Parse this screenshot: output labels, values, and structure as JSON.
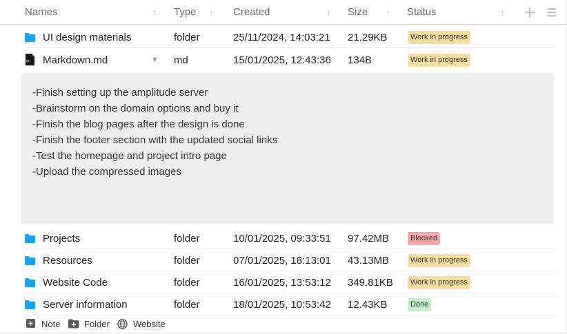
{
  "header": {
    "columns": [
      {
        "label": "Names"
      },
      {
        "label": "Type"
      },
      {
        "label": "Created"
      },
      {
        "label": "Size"
      },
      {
        "label": "Status"
      }
    ],
    "sort_glyph": "↑",
    "add_icon": "plus-icon",
    "menu_icon": "hamburger-menu-icon"
  },
  "rows": [
    {
      "name": "UI design materials",
      "icon": "folder-icon",
      "type": "folder",
      "created": "25/11/2024, 14:03:21",
      "size": "21.29KB",
      "status": "Work in progress",
      "status_kind": "progress"
    },
    {
      "name": "Markdown.md",
      "icon": "markdown-file-icon",
      "type": "md",
      "created": "15/01/2025, 12:43:36",
      "size": "134B",
      "status": "Work in progress",
      "status_kind": "progress",
      "expanded": true,
      "caret": "▼"
    },
    {
      "name": "Projects",
      "icon": "folder-icon",
      "type": "folder",
      "created": "10/01/2025, 09:33:51",
      "size": "97.42MB",
      "status": "Blocked",
      "status_kind": "blocked"
    },
    {
      "name": "Resources",
      "icon": "folder-icon",
      "type": "folder",
      "created": "07/01/2025, 18:13:01",
      "size": "43.13MB",
      "status": "Work in progress",
      "status_kind": "progress"
    },
    {
      "name": "Website Code",
      "icon": "folder-icon",
      "type": "folder",
      "created": "16/01/2025, 13:53:12",
      "size": "349.81KB",
      "status": "Work in progress",
      "status_kind": "progress"
    },
    {
      "name": "Server information",
      "icon": "folder-icon",
      "type": "folder",
      "created": "18/01/2025, 10:53:42",
      "size": "12.43KB",
      "status": "Done",
      "status_kind": "done"
    }
  ],
  "preview": {
    "lines": [
      "-Finish setting up the amplitude server",
      "-Brainstorm on the domain options and buy it",
      "-Finish the blog pages after the design is done",
      "-Finish the footer section with the updated social links",
      "-Test the homepage and project intro page",
      "-Upload the compressed images"
    ]
  },
  "footer": {
    "buttons": [
      {
        "label": "Note",
        "icon": "add-note-icon"
      },
      {
        "label": "Folder",
        "icon": "add-folder-icon"
      },
      {
        "label": "Website",
        "icon": "globe-icon"
      }
    ]
  },
  "colors": {
    "folder": "#1aa3e8",
    "status_progress": "#f8dfa1",
    "status_blocked": "#f6a7a7",
    "status_done": "#c2f0cd",
    "preview_bg": "#eeeeee"
  }
}
